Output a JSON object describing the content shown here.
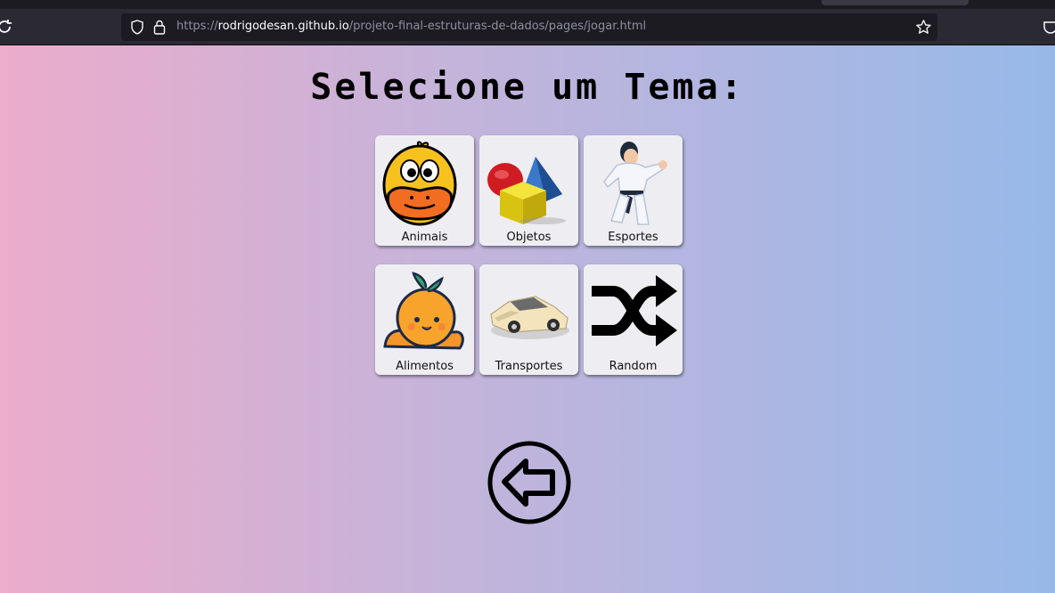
{
  "browser": {
    "url_prefix": "https://",
    "url_domain": "rodrigodesan.github.io",
    "url_path": "/projeto-final-estruturas-de-dados/pages/jogar.html"
  },
  "page": {
    "title": "Selecione um Tema:",
    "themes": [
      {
        "label": "Animais",
        "icon": "duck-icon"
      },
      {
        "label": "Objetos",
        "icon": "shapes-icon"
      },
      {
        "label": "Esportes",
        "icon": "karate-icon"
      },
      {
        "label": "Alimentos",
        "icon": "orange-icon"
      },
      {
        "label": "Transportes",
        "icon": "car-icon"
      },
      {
        "label": "Random",
        "icon": "shuffle-icon"
      }
    ],
    "back_icon": "back-arrow-icon"
  },
  "colors": {
    "gradient_left": "#ecaccb",
    "gradient_mid": "#c2b4db",
    "gradient_right": "#97b9e8",
    "card_bg": "#eeeef2"
  }
}
